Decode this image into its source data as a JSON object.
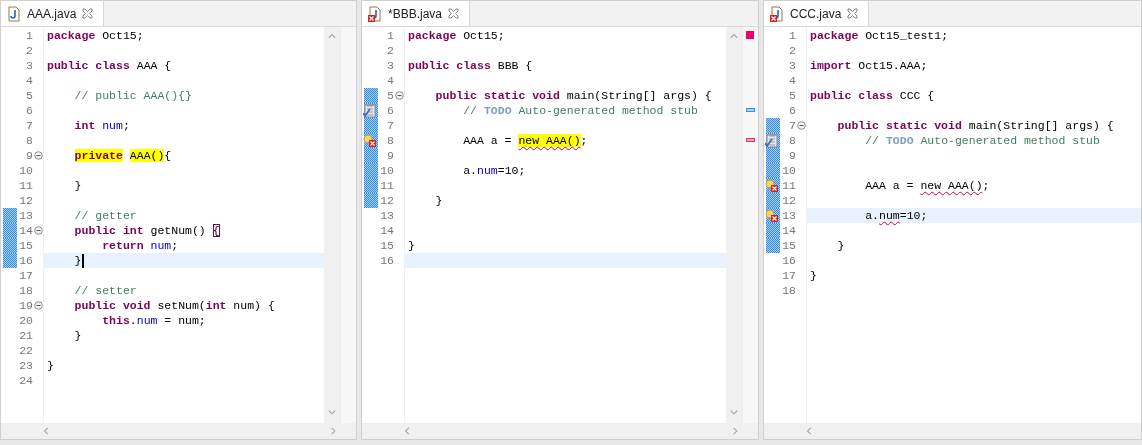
{
  "editors": [
    {
      "tab": {
        "label": "AAA.java",
        "errors": false,
        "selected": true
      },
      "scrollbar": true,
      "lines": [
        {
          "number": "1",
          "tokens": [
            {
              "text": "package",
              "kind": "keyword"
            },
            {
              "text": " Oct15;",
              "kind": "plain"
            }
          ]
        },
        {
          "number": "2"
        },
        {
          "number": "3",
          "tokens": [
            {
              "text": "public class",
              "kind": "keyword"
            },
            {
              "text": " AAA {",
              "kind": "plain"
            }
          ]
        },
        {
          "number": "4"
        },
        {
          "number": "5",
          "tokens": [
            {
              "text": "    // public AAA(){}",
              "kind": "comment"
            }
          ]
        },
        {
          "number": "6"
        },
        {
          "number": "7",
          "tokens": [
            {
              "text": "    int ",
              "kind": "keyword"
            },
            {
              "text": "num",
              "kind": "field"
            },
            {
              "text": ";",
              "kind": "plain"
            }
          ]
        },
        {
          "number": "8"
        },
        {
          "number": "9",
          "foldable": true,
          "tokens": [
            {
              "text": "    private",
              "kind": "keyword",
              "highlight": true
            },
            {
              "text": " AAA()",
              "kind": "plain",
              "highlight": true
            },
            {
              "text": "{",
              "kind": "plain"
            }
          ]
        },
        {
          "number": "10"
        },
        {
          "number": "11",
          "tokens": [
            {
              "text": "    }",
              "kind": "plain"
            }
          ]
        },
        {
          "number": "12"
        },
        {
          "number": "13",
          "changed": true,
          "tokens": [
            {
              "text": "    // getter",
              "kind": "comment"
            }
          ]
        },
        {
          "number": "14",
          "changed": true,
          "foldable": true,
          "tokens": [
            {
              "text": "    public int",
              "kind": "keyword"
            },
            {
              "text": " getNum() ",
              "kind": "plain"
            },
            {
              "text": "{",
              "kind": "plain",
              "boxed": true
            }
          ]
        },
        {
          "number": "15",
          "changed": true,
          "tokens": [
            {
              "text": "        return ",
              "kind": "keyword"
            },
            {
              "text": "num",
              "kind": "field"
            },
            {
              "text": ";",
              "kind": "plain"
            }
          ]
        },
        {
          "number": "16",
          "changed": true,
          "current": true,
          "caret": true,
          "tokens": [
            {
              "text": "    }",
              "kind": "plain"
            }
          ]
        },
        {
          "number": "17"
        },
        {
          "number": "18",
          "tokens": [
            {
              "text": "    // setter",
              "kind": "comment"
            }
          ]
        },
        {
          "number": "19",
          "foldable": true,
          "tokens": [
            {
              "text": "    public void",
              "kind": "keyword"
            },
            {
              "text": " setNum(",
              "kind": "plain"
            },
            {
              "text": "int",
              "kind": "keyword"
            },
            {
              "text": " num) {",
              "kind": "plain"
            }
          ]
        },
        {
          "number": "20",
          "tokens": [
            {
              "text": "        this",
              "kind": "keyword"
            },
            {
              "text": ".",
              "kind": "plain"
            },
            {
              "text": "num",
              "kind": "field"
            },
            {
              "text": " = num;",
              "kind": "plain"
            }
          ]
        },
        {
          "number": "21",
          "tokens": [
            {
              "text": "    }",
              "kind": "plain"
            }
          ]
        },
        {
          "number": "22"
        },
        {
          "number": "23",
          "tokens": [
            {
              "text": "}",
              "kind": "plain"
            }
          ]
        },
        {
          "number": "24"
        }
      ]
    },
    {
      "tab": {
        "label": "*BBB.java",
        "errors": true,
        "selected": true
      },
      "scrollbar": true,
      "lines": [
        {
          "number": "1",
          "tokens": [
            {
              "text": "package",
              "kind": "keyword"
            },
            {
              "text": " Oct15;",
              "kind": "plain"
            }
          ]
        },
        {
          "number": "2"
        },
        {
          "number": "3",
          "tokens": [
            {
              "text": "public class",
              "kind": "keyword"
            },
            {
              "text": " BBB {",
              "kind": "plain"
            }
          ]
        },
        {
          "number": "4"
        },
        {
          "number": "5",
          "changed": true,
          "foldable": true,
          "tokens": [
            {
              "text": "    public static void",
              "kind": "keyword"
            },
            {
              "text": " main(String[] args) {",
              "kind": "plain"
            }
          ]
        },
        {
          "number": "6",
          "changed": true,
          "task": true,
          "tokens": [
            {
              "text": "        // ",
              "kind": "comment"
            },
            {
              "text": "TODO",
              "kind": "task"
            },
            {
              "text": " Auto-generated method stub",
              "kind": "comment"
            }
          ]
        },
        {
          "number": "7",
          "changed": true
        },
        {
          "number": "8",
          "changed": true,
          "problem": true,
          "tokens": [
            {
              "text": "        AAA a = ",
              "kind": "plain"
            },
            {
              "text": "new AAA()",
              "kind": "plain",
              "highlight": true,
              "error": true
            },
            {
              "text": ";",
              "kind": "plain"
            }
          ]
        },
        {
          "number": "9",
          "changed": true
        },
        {
          "number": "10",
          "changed": true,
          "tokens": [
            {
              "text": "        a.",
              "kind": "plain"
            },
            {
              "text": "num",
              "kind": "field"
            },
            {
              "text": "=10;",
              "kind": "plain"
            }
          ]
        },
        {
          "number": "11",
          "changed": true
        },
        {
          "number": "12",
          "changed": true,
          "tokens": [
            {
              "text": "    }",
              "kind": "plain"
            }
          ]
        },
        {
          "number": "13"
        },
        {
          "number": "14"
        },
        {
          "number": "15",
          "tokens": [
            {
              "text": "}",
              "kind": "plain"
            }
          ]
        },
        {
          "number": "16",
          "current": true
        }
      ]
    },
    {
      "tab": {
        "label": "CCC.java",
        "errors": true,
        "selected": true
      },
      "scrollbar": false,
      "lines": [
        {
          "number": "1",
          "tokens": [
            {
              "text": "package",
              "kind": "keyword"
            },
            {
              "text": " Oct15_test1;",
              "kind": "plain"
            }
          ]
        },
        {
          "number": "2"
        },
        {
          "number": "3",
          "tokens": [
            {
              "text": "import",
              "kind": "keyword"
            },
            {
              "text": " Oct15.AAA;",
              "kind": "plain"
            }
          ]
        },
        {
          "number": "4"
        },
        {
          "number": "5",
          "tokens": [
            {
              "text": "public class",
              "kind": "keyword"
            },
            {
              "text": " CCC {",
              "kind": "plain"
            }
          ]
        },
        {
          "number": "6"
        },
        {
          "number": "7",
          "changed": true,
          "foldable": true,
          "tokens": [
            {
              "text": "    public static void",
              "kind": "keyword"
            },
            {
              "text": " main(String[] args) {",
              "kind": "plain"
            }
          ]
        },
        {
          "number": "8",
          "changed": true,
          "task": true,
          "tokens": [
            {
              "text": "        // ",
              "kind": "comment"
            },
            {
              "text": "TODO",
              "kind": "task"
            },
            {
              "text": " Auto-generated method stub",
              "kind": "comment"
            }
          ]
        },
        {
          "number": "9",
          "changed": true
        },
        {
          "number": "10",
          "changed": true
        },
        {
          "number": "11",
          "changed": true,
          "problem": true,
          "tokens": [
            {
              "text": "        AAA a = ",
              "kind": "plain"
            },
            {
              "text": "new AAA()",
              "kind": "plain",
              "error": true
            },
            {
              "text": ";",
              "kind": "plain"
            }
          ]
        },
        {
          "number": "12",
          "changed": true
        },
        {
          "number": "13",
          "changed": true,
          "current": true,
          "problem": true,
          "tokens": [
            {
              "text": "        a.",
              "kind": "plain"
            },
            {
              "text": "num",
              "kind": "plain",
              "error": true
            },
            {
              "text": "=10;",
              "kind": "plain"
            }
          ]
        },
        {
          "number": "14",
          "changed": true
        },
        {
          "number": "15",
          "changed": true,
          "tokens": [
            {
              "text": "    }",
              "kind": "plain"
            }
          ]
        },
        {
          "number": "16"
        },
        {
          "number": "17",
          "tokens": [
            {
              "text": "}",
              "kind": "plain"
            }
          ]
        },
        {
          "number": "18"
        }
      ]
    }
  ]
}
